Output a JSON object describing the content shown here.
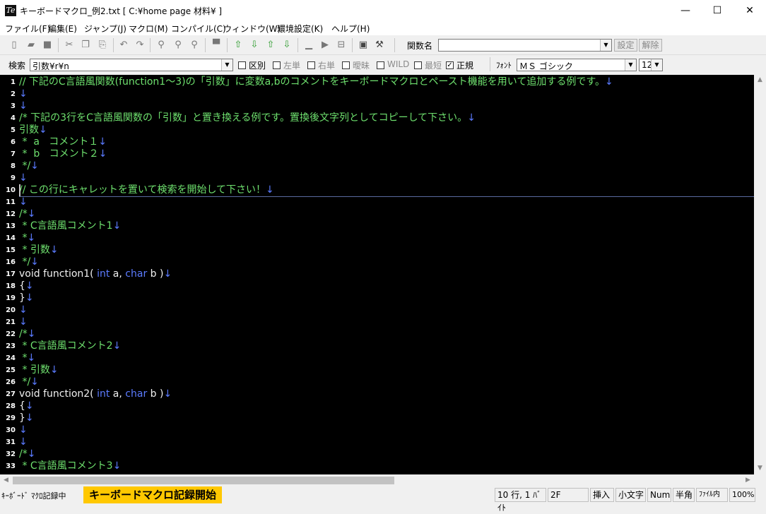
{
  "window": {
    "title": "キーボードマクロ_例2.txt [ C:¥home page 材料¥ ]",
    "app_icon": "Te",
    "minimize": "—",
    "maximize": "☐",
    "close": "✕"
  },
  "menu": [
    "ファイル(F)",
    "編集(E)",
    "ジャンプ(J)",
    "マクロ(M)",
    "コンパイル(C)",
    "ウィンドウ(W)",
    "環境設定(K)",
    "ヘルプ(H)"
  ],
  "toolbar": {
    "func_label": "関数名",
    "func_value": "",
    "set_button": "設定",
    "release_button": "解除"
  },
  "search_bar": {
    "search_label": "検索",
    "search_value": "引数¥r¥n",
    "checkboxes": [
      {
        "label": "区別",
        "checked": false,
        "enabled": true
      },
      {
        "label": "左単",
        "checked": false,
        "enabled": false
      },
      {
        "label": "右単",
        "checked": false,
        "enabled": false
      },
      {
        "label": "曖昧",
        "checked": false,
        "enabled": false
      },
      {
        "label": "WILD",
        "checked": false,
        "enabled": false
      },
      {
        "label": "最短",
        "checked": false,
        "enabled": false
      },
      {
        "label": "正規",
        "checked": true,
        "enabled": true
      }
    ],
    "font_label": "ﾌｫﾝﾄ",
    "font_value": "ＭＳ ゴシック",
    "size_value": "12"
  },
  "editor": {
    "caret_line": 10,
    "lines": [
      {
        "n": "1",
        "seg": [
          [
            "// 下記のC言語風関数(function1～3)の「引数」に変数a,bのコメントをキーボードマクロとペースト機能を用いて追加する例です。",
            "green"
          ],
          [
            "↓",
            "blue"
          ]
        ]
      },
      {
        "n": "2",
        "seg": [
          [
            "↓",
            "blue"
          ]
        ]
      },
      {
        "n": "3",
        "seg": [
          [
            "↓",
            "blue"
          ]
        ]
      },
      {
        "n": "4",
        "seg": [
          [
            "/* 下記の3行をC言語風関数の「引数」と置き換える例です。置換後文字列としてコピーして下さい。",
            "green"
          ],
          [
            "↓",
            "blue"
          ]
        ]
      },
      {
        "n": "5",
        "seg": [
          [
            "引数",
            "green"
          ],
          [
            "↓",
            "blue"
          ]
        ]
      },
      {
        "n": "6",
        "seg": [
          [
            " *  a   コメント１",
            "green"
          ],
          [
            "↓",
            "blue"
          ]
        ]
      },
      {
        "n": "7",
        "seg": [
          [
            " *  b   コメント２",
            "green"
          ],
          [
            "↓",
            "blue"
          ]
        ]
      },
      {
        "n": "8",
        "seg": [
          [
            " */",
            "green"
          ],
          [
            "↓",
            "blue"
          ]
        ]
      },
      {
        "n": "9",
        "seg": [
          [
            "↓",
            "blue"
          ]
        ]
      },
      {
        "n": "10",
        "seg": [
          [
            "// この行にキャレットを置いて検索を開始して下さい！",
            "green"
          ],
          [
            "↓",
            "blue"
          ]
        ]
      },
      {
        "n": "11",
        "seg": [
          [
            "↓",
            "blue"
          ]
        ]
      },
      {
        "n": "12",
        "seg": [
          [
            "/*",
            "green"
          ],
          [
            "↓",
            "blue"
          ]
        ]
      },
      {
        "n": "13",
        "seg": [
          [
            " * C言語風コメント1",
            "green"
          ],
          [
            "↓",
            "blue"
          ]
        ]
      },
      {
        "n": "14",
        "seg": [
          [
            " *",
            "green"
          ],
          [
            "↓",
            "blue"
          ]
        ]
      },
      {
        "n": "15",
        "seg": [
          [
            " * 引数",
            "green"
          ],
          [
            "↓",
            "blue"
          ]
        ]
      },
      {
        "n": "16",
        "seg": [
          [
            " */",
            "green"
          ],
          [
            "↓",
            "blue"
          ]
        ]
      },
      {
        "n": "17",
        "seg": [
          [
            "void function1( ",
            "white"
          ],
          [
            "int",
            "blue"
          ],
          [
            " a, ",
            "white"
          ],
          [
            "char",
            "blue"
          ],
          [
            " b )",
            "white"
          ],
          [
            "↓",
            "blue"
          ]
        ]
      },
      {
        "n": "18",
        "seg": [
          [
            "{",
            "white"
          ],
          [
            "↓",
            "blue"
          ]
        ]
      },
      {
        "n": "19",
        "seg": [
          [
            "}",
            "white"
          ],
          [
            "↓",
            "blue"
          ]
        ]
      },
      {
        "n": "20",
        "seg": [
          [
            "↓",
            "blue"
          ]
        ]
      },
      {
        "n": "21",
        "seg": [
          [
            "↓",
            "blue"
          ]
        ]
      },
      {
        "n": "22",
        "seg": [
          [
            "/*",
            "green"
          ],
          [
            "↓",
            "blue"
          ]
        ]
      },
      {
        "n": "23",
        "seg": [
          [
            " * C言語風コメント2",
            "green"
          ],
          [
            "↓",
            "blue"
          ]
        ]
      },
      {
        "n": "24",
        "seg": [
          [
            " *",
            "green"
          ],
          [
            "↓",
            "blue"
          ]
        ]
      },
      {
        "n": "25",
        "seg": [
          [
            " * 引数",
            "green"
          ],
          [
            "↓",
            "blue"
          ]
        ]
      },
      {
        "n": "26",
        "seg": [
          [
            " */",
            "green"
          ],
          [
            "↓",
            "blue"
          ]
        ]
      },
      {
        "n": "27",
        "seg": [
          [
            "void function2( ",
            "white"
          ],
          [
            "int",
            "blue"
          ],
          [
            " a, ",
            "white"
          ],
          [
            "char",
            "blue"
          ],
          [
            " b )",
            "white"
          ],
          [
            "↓",
            "blue"
          ]
        ]
      },
      {
        "n": "28",
        "seg": [
          [
            "{",
            "white"
          ],
          [
            "↓",
            "blue"
          ]
        ]
      },
      {
        "n": "29",
        "seg": [
          [
            "}",
            "white"
          ],
          [
            "↓",
            "blue"
          ]
        ]
      },
      {
        "n": "30",
        "seg": [
          [
            "↓",
            "blue"
          ]
        ]
      },
      {
        "n": "31",
        "seg": [
          [
            "↓",
            "blue"
          ]
        ]
      },
      {
        "n": "32",
        "seg": [
          [
            "/*",
            "green"
          ],
          [
            "↓",
            "blue"
          ]
        ]
      },
      {
        "n": "33",
        "seg": [
          [
            " * C言語風コメント3",
            "green"
          ],
          [
            "↓",
            "blue"
          ]
        ]
      }
    ]
  },
  "status": {
    "macro_status": "ｷｰﾎﾞｰﾄﾞ ﾏｸﾛ記録中",
    "banner": "キーボードマクロ記録開始",
    "position": "10 行, 1 ﾊﾞｲﾄ",
    "code": "2F",
    "insert": "挿入",
    "lowercase": "小文字",
    "num": "Num",
    "halfwidth": "半角",
    "scope": "ﾌｧｲﾙ内",
    "zoom": "100%"
  },
  "colors": {
    "green": "#6ee06e",
    "white": "#f0f0f0",
    "blue": "#5b7bff",
    "banner": "#ffc800"
  }
}
